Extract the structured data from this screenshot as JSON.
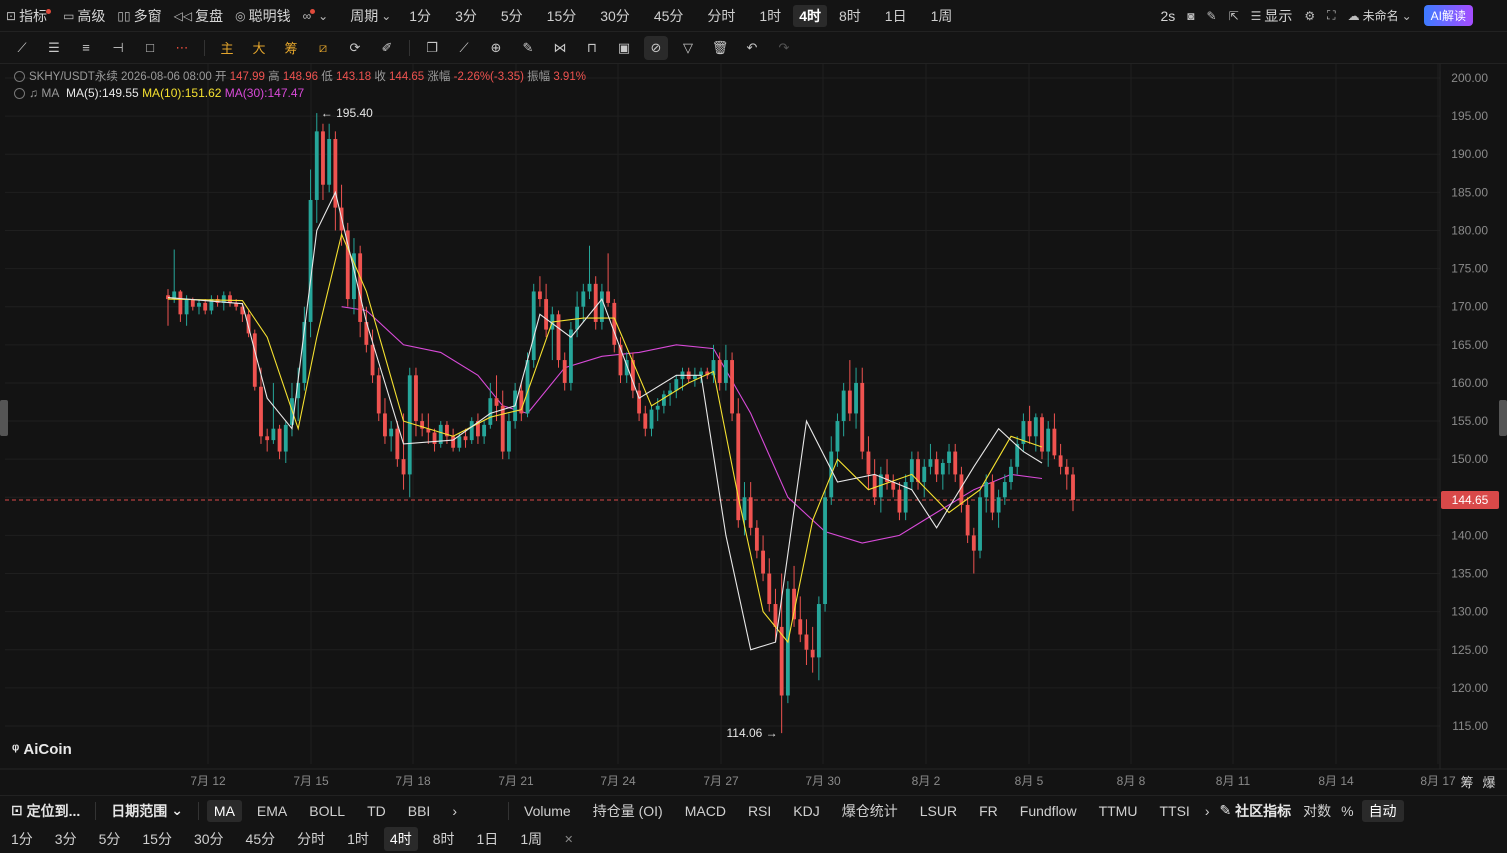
{
  "topbar": {
    "items": [
      {
        "icon": "chart-box-icon",
        "label": "指标",
        "dot": true
      },
      {
        "icon": "folder-icon",
        "label": "高级"
      },
      {
        "icon": "grid-icon",
        "label": "多窗"
      },
      {
        "icon": "rewind-icon",
        "label": "复盘"
      },
      {
        "icon": "brain-icon",
        "label": "聪明钱"
      },
      {
        "icon": "glasses-icon",
        "label": "",
        "dot": true
      }
    ],
    "period_dropdown": "周期",
    "periods": [
      "1分",
      "3分",
      "5分",
      "15分",
      "30分",
      "45分",
      "分时",
      "1时",
      "4时",
      "8时",
      "1日",
      "1周"
    ],
    "active_period": "4时",
    "refresh": "2s",
    "display_label": "显示",
    "unnamed_label": "未命名",
    "ai_label": "AI解读"
  },
  "toolbar": {
    "tools_left": [
      "line-icon",
      "parallel-icon",
      "horizontal-lines-icon",
      "ray-icon",
      "rect-icon",
      "dots-icon"
    ],
    "text_tools": [
      "主",
      "大",
      "筹"
    ],
    "tools_right": [
      "measure-icon",
      "pattern-icon",
      "pencil-icon",
      "clone-icon",
      "ruler-icon",
      "zoom-icon",
      "brush-icon",
      "magnet-icon",
      "lock-icon",
      "ruler2-icon",
      "link-icon",
      "filter-icon",
      "trash-icon",
      "undo-icon",
      "redo-icon"
    ]
  },
  "header": {
    "symbol": "SKHY/USDT永续",
    "datetime": "2026-08-06 08:00",
    "open_label": "开",
    "open": "147.99",
    "high_label": "高",
    "high": "148.96",
    "low_label": "低",
    "low": "143.18",
    "close_label": "收",
    "close": "144.65",
    "change_label": "涨幅",
    "change": "-2.26%(-3.35)",
    "amp_label": "振幅",
    "amp": "3.91%",
    "ma_label": "MA",
    "ma5": "MA(5):149.55",
    "ma10": "MA(10):151.62",
    "ma30": "MA(30):147.47"
  },
  "colors": {
    "up": "#26a69a",
    "down": "#ef5350",
    "ma5": "#e8e8e8",
    "ma10": "#f5e130",
    "ma30": "#d84ad8",
    "price_line": "#d94949"
  },
  "current_price": "144.65",
  "max_label": "195.40",
  "min_label": "114.06",
  "logo": "AiCoin",
  "chart_data": {
    "type": "candlestick",
    "symbol": "SKHY/USDT永续",
    "interval": "4h",
    "y_ticks": [
      115,
      120,
      125,
      130,
      135,
      140,
      145,
      150,
      155,
      160,
      165,
      170,
      175,
      180,
      185,
      190,
      195,
      200
    ],
    "y_tick_labels": [
      "115.00",
      "120.00",
      "125.00",
      "130.00",
      "135.00",
      "140.00",
      "145.00",
      "150.00",
      "155.00",
      "160.00",
      "165.00",
      "170.00",
      "175.00",
      "180.00",
      "185.00",
      "190.00",
      "195.00",
      "200.00"
    ],
    "x_labels": [
      "7月 12",
      "7月 15",
      "7月 18",
      "7月 21",
      "7月 24",
      "7月 27",
      "7月 30",
      "8月 2",
      "8月 5",
      "8月 8",
      "8月 11",
      "8月 14",
      "8月 17"
    ],
    "ylim": [
      112,
      202
    ],
    "candles": [
      [
        171.5,
        172.3,
        167.5,
        171.0
      ],
      [
        171.0,
        177.5,
        170.5,
        172.0
      ],
      [
        172.0,
        172.2,
        168.0,
        169.0
      ],
      [
        169.0,
        171.5,
        167.5,
        171.0
      ],
      [
        171.0,
        171.2,
        169.5,
        170.0
      ],
      [
        170.0,
        171.0,
        169.0,
        170.5
      ],
      [
        170.5,
        171.0,
        169.0,
        169.5
      ],
      [
        169.5,
        171.5,
        169.0,
        171.0
      ],
      [
        171.0,
        171.5,
        170.0,
        170.5
      ],
      [
        170.5,
        172.0,
        169.5,
        171.5
      ],
      [
        171.5,
        172.0,
        170.0,
        170.5
      ],
      [
        170.5,
        171.0,
        169.5,
        170.0
      ],
      [
        170.0,
        170.5,
        168.0,
        169.0
      ],
      [
        169.0,
        169.5,
        166.0,
        166.5
      ],
      [
        166.5,
        167.0,
        159.0,
        159.5
      ],
      [
        159.5,
        162.0,
        152.0,
        153.0
      ],
      [
        153.0,
        154.0,
        151.0,
        152.5
      ],
      [
        152.5,
        160.0,
        152.0,
        154.0
      ],
      [
        154.0,
        154.5,
        150.0,
        151.0
      ],
      [
        151.0,
        155.0,
        149.5,
        154.5
      ],
      [
        154.5,
        160.0,
        153.0,
        158.0
      ],
      [
        158.0,
        162.0,
        155.0,
        160.0
      ],
      [
        160.0,
        170.0,
        159.0,
        168.0
      ],
      [
        168.0,
        188.0,
        166.0,
        184.0
      ],
      [
        184.0,
        195.4,
        181.0,
        193.0
      ],
      [
        193.0,
        194.0,
        184.0,
        186.0
      ],
      [
        186.0,
        194.0,
        185.0,
        192.0
      ],
      [
        192.0,
        193.0,
        180.0,
        183.0
      ],
      [
        183.0,
        186.0,
        178.0,
        180.0
      ],
      [
        180.0,
        181.0,
        170.0,
        171.0
      ],
      [
        171.0,
        179.0,
        169.0,
        177.0
      ],
      [
        177.0,
        178.0,
        166.0,
        168.0
      ],
      [
        168.0,
        170.0,
        164.0,
        165.0
      ],
      [
        165.0,
        167.0,
        160.0,
        161.0
      ],
      [
        161.0,
        162.0,
        155.0,
        156.0
      ],
      [
        156.0,
        158.0,
        152.0,
        153.0
      ],
      [
        153.0,
        155.0,
        151.0,
        154.0
      ],
      [
        154.0,
        155.0,
        149.0,
        150.0
      ],
      [
        150.0,
        156.0,
        146.0,
        148.0
      ],
      [
        148.0,
        162.0,
        145.0,
        161.0
      ],
      [
        161.0,
        162.0,
        153.0,
        155.0
      ],
      [
        155.0,
        156.0,
        153.0,
        154.0
      ],
      [
        154.0,
        156.0,
        152.0,
        153.5
      ],
      [
        153.5,
        154.0,
        151.0,
        152.0
      ],
      [
        152.0,
        155.0,
        151.5,
        154.5
      ],
      [
        154.5,
        155.0,
        152.0,
        153.0
      ],
      [
        153.0,
        154.0,
        151.0,
        151.5
      ],
      [
        151.5,
        153.5,
        151.0,
        153.0
      ],
      [
        153.0,
        154.0,
        151.5,
        152.5
      ],
      [
        152.5,
        155.5,
        152.0,
        155.0
      ],
      [
        155.0,
        156.0,
        152.0,
        153.0
      ],
      [
        153.0,
        155.0,
        152.0,
        154.5
      ],
      [
        154.5,
        160.0,
        154.0,
        158.0
      ],
      [
        158.0,
        161.0,
        155.0,
        157.0
      ],
      [
        157.0,
        159.0,
        150.0,
        151.0
      ],
      [
        151.0,
        156.0,
        150.0,
        155.0
      ],
      [
        155.0,
        160.0,
        154.0,
        159.0
      ],
      [
        159.0,
        160.0,
        155.0,
        156.0
      ],
      [
        156.0,
        164.0,
        155.5,
        163.0
      ],
      [
        163.0,
        173.0,
        162.0,
        172.0
      ],
      [
        172.0,
        174.0,
        170.0,
        171.0
      ],
      [
        171.0,
        173.0,
        166.0,
        167.0
      ],
      [
        167.0,
        170.0,
        163.0,
        169.0
      ],
      [
        169.0,
        169.5,
        162.0,
        163.0
      ],
      [
        163.0,
        164.0,
        159.0,
        160.0
      ],
      [
        160.0,
        168.0,
        159.0,
        167.0
      ],
      [
        167.0,
        172.0,
        166.0,
        170.0
      ],
      [
        170.0,
        173.0,
        168.0,
        172.0
      ],
      [
        172.0,
        178.0,
        171.0,
        173.0
      ],
      [
        173.0,
        174.0,
        167.0,
        168.0
      ],
      [
        168.0,
        173.0,
        167.0,
        172.0
      ],
      [
        172.0,
        177.0,
        170.0,
        170.5
      ],
      [
        170.5,
        171.0,
        164.0,
        165.0
      ],
      [
        165.0,
        166.0,
        160.0,
        161.0
      ],
      [
        161.0,
        164.0,
        160.0,
        163.0
      ],
      [
        163.0,
        164.0,
        158.0,
        159.0
      ],
      [
        159.0,
        160.0,
        155.0,
        156.0
      ],
      [
        156.0,
        157.0,
        153.0,
        154.0
      ],
      [
        154.0,
        157.0,
        153.0,
        156.5
      ],
      [
        156.5,
        158.0,
        155.0,
        157.0
      ],
      [
        157.0,
        159.0,
        156.0,
        158.5
      ],
      [
        158.5,
        160.0,
        157.0,
        159.0
      ],
      [
        159.0,
        161.0,
        158.0,
        160.5
      ],
      [
        160.5,
        162.0,
        159.0,
        161.5
      ],
      [
        161.5,
        162.0,
        160.0,
        160.5
      ],
      [
        160.5,
        162.0,
        159.5,
        161.0
      ],
      [
        161.0,
        162.0,
        160.0,
        161.5
      ],
      [
        161.5,
        162.0,
        160.5,
        161.0
      ],
      [
        161.0,
        165.0,
        160.0,
        163.0
      ],
      [
        163.0,
        164.0,
        159.0,
        160.0
      ],
      [
        160.0,
        165.0,
        159.0,
        163.0
      ],
      [
        163.0,
        164.0,
        155.0,
        156.0
      ],
      [
        156.0,
        158.0,
        141.0,
        142.0
      ],
      [
        142.0,
        147.0,
        140.0,
        145.0
      ],
      [
        145.0,
        147.0,
        140.0,
        141.0
      ],
      [
        141.0,
        142.0,
        137.0,
        138.0
      ],
      [
        138.0,
        140.0,
        134.0,
        135.0
      ],
      [
        135.0,
        137.0,
        130.0,
        131.0
      ],
      [
        131.0,
        133.0,
        126.0,
        128.0
      ],
      [
        128.0,
        135.0,
        114.06,
        119.0
      ],
      [
        119.0,
        134.0,
        118.0,
        133.0
      ],
      [
        133.0,
        136.0,
        128.0,
        129.0
      ],
      [
        129.0,
        132.0,
        126.0,
        127.0
      ],
      [
        127.0,
        129.0,
        123.0,
        125.0
      ],
      [
        125.0,
        128.0,
        122.0,
        124.0
      ],
      [
        124.0,
        132.0,
        121.0,
        131.0
      ],
      [
        131.0,
        146.0,
        130.0,
        145.0
      ],
      [
        145.0,
        153.0,
        144.0,
        151.0
      ],
      [
        151.0,
        156.0,
        149.0,
        155.0
      ],
      [
        155.0,
        160.0,
        153.0,
        159.0
      ],
      [
        159.0,
        163.0,
        155.0,
        156.0
      ],
      [
        156.0,
        162.0,
        154.0,
        160.0
      ],
      [
        160.0,
        162.0,
        150.0,
        151.0
      ],
      [
        151.0,
        153.0,
        146.0,
        148.0
      ],
      [
        148.0,
        150.0,
        144.0,
        145.0
      ],
      [
        145.0,
        149.0,
        143.0,
        148.0
      ],
      [
        148.0,
        150.0,
        146.0,
        147.0
      ],
      [
        147.0,
        148.0,
        145.0,
        146.0
      ],
      [
        146.0,
        147.0,
        142.0,
        143.0
      ],
      [
        143.0,
        148.0,
        142.0,
        147.0
      ],
      [
        147.0,
        151.0,
        146.0,
        150.0
      ],
      [
        150.0,
        151.0,
        146.0,
        147.0
      ],
      [
        147.0,
        150.0,
        145.0,
        149.0
      ],
      [
        149.0,
        152.0,
        148.0,
        150.0
      ],
      [
        150.0,
        151.0,
        147.0,
        148.0
      ],
      [
        148.0,
        150.0,
        146.0,
        149.5
      ],
      [
        149.5,
        152.0,
        148.0,
        151.0
      ],
      [
        151.0,
        152.0,
        147.0,
        148.0
      ],
      [
        148.0,
        149.0,
        143.0,
        144.0
      ],
      [
        144.0,
        145.0,
        139.0,
        140.0
      ],
      [
        140.0,
        141.0,
        135.0,
        138.0
      ],
      [
        138.0,
        146.0,
        137.0,
        145.0
      ],
      [
        145.0,
        148.0,
        143.0,
        147.0
      ],
      [
        147.0,
        148.0,
        142.0,
        143.0
      ],
      [
        143.0,
        146.0,
        141.0,
        145.0
      ],
      [
        145.0,
        148.0,
        144.0,
        147.0
      ],
      [
        147.0,
        150.0,
        146.0,
        149.0
      ],
      [
        149.0,
        153.0,
        148.0,
        152.0
      ],
      [
        152.0,
        156.0,
        151.0,
        155.0
      ],
      [
        155.0,
        157.0,
        152.0,
        153.0
      ],
      [
        153.0,
        156.0,
        151.0,
        155.5
      ],
      [
        155.5,
        156.0,
        150.0,
        151.0
      ],
      [
        151.0,
        155.0,
        149.0,
        154.0
      ],
      [
        154.0,
        156.0,
        150.0,
        150.5
      ],
      [
        150.5,
        152.0,
        148.0,
        149.0
      ],
      [
        149.0,
        150.0,
        146.0,
        147.99
      ],
      [
        147.99,
        148.96,
        143.18,
        144.65
      ]
    ],
    "ma5": [
      [
        0,
        171.2
      ],
      [
        12,
        170.4
      ],
      [
        16,
        158.0
      ],
      [
        20,
        154.0
      ],
      [
        24,
        180.0
      ],
      [
        27,
        185.0
      ],
      [
        32,
        168.0
      ],
      [
        38,
        152.0
      ],
      [
        46,
        152.5
      ],
      [
        52,
        156.0
      ],
      [
        56,
        157.0
      ],
      [
        60,
        169.0
      ],
      [
        65,
        166.0
      ],
      [
        70,
        171.0
      ],
      [
        76,
        158.0
      ],
      [
        82,
        161.0
      ],
      [
        86,
        161.0
      ],
      [
        90,
        140.0
      ],
      [
        94,
        125.0
      ],
      [
        98,
        126.0
      ],
      [
        103,
        155.0
      ],
      [
        108,
        147.0
      ],
      [
        114,
        148.0
      ],
      [
        120,
        146.0
      ],
      [
        124,
        141.0
      ],
      [
        130,
        149.0
      ],
      [
        134,
        154.0
      ],
      [
        138,
        151.0
      ],
      [
        141,
        149.5
      ]
    ],
    "ma10": [
      [
        0,
        171.0
      ],
      [
        12,
        170.8
      ],
      [
        16,
        166.0
      ],
      [
        21,
        154.0
      ],
      [
        24,
        166.0
      ],
      [
        28,
        179.5
      ],
      [
        32,
        172.0
      ],
      [
        38,
        155.0
      ],
      [
        46,
        153.0
      ],
      [
        52,
        155.5
      ],
      [
        57,
        156.5
      ],
      [
        62,
        168.0
      ],
      [
        67,
        168.5
      ],
      [
        72,
        168.5
      ],
      [
        78,
        157.0
      ],
      [
        84,
        160.0
      ],
      [
        88,
        161.5
      ],
      [
        92,
        145.0
      ],
      [
        96,
        130.0
      ],
      [
        100,
        126.0
      ],
      [
        104,
        142.0
      ],
      [
        108,
        150.0
      ],
      [
        113,
        146.0
      ],
      [
        120,
        148.0
      ],
      [
        126,
        143.0
      ],
      [
        131,
        146.0
      ],
      [
        136,
        153.0
      ],
      [
        141,
        151.6
      ]
    ],
    "ma30": [
      [
        28,
        170.0
      ],
      [
        32,
        169.5
      ],
      [
        38,
        165.0
      ],
      [
        44,
        164.0
      ],
      [
        50,
        161.0
      ],
      [
        54,
        157.0
      ],
      [
        58,
        156.0
      ],
      [
        64,
        162.0
      ],
      [
        70,
        163.5
      ],
      [
        76,
        164.0
      ],
      [
        82,
        165.0
      ],
      [
        88,
        164.5
      ],
      [
        94,
        156.0
      ],
      [
        100,
        145.0
      ],
      [
        106,
        140.5
      ],
      [
        112,
        139.0
      ],
      [
        118,
        140.0
      ],
      [
        124,
        143.0
      ],
      [
        130,
        146.0
      ],
      [
        136,
        148.0
      ],
      [
        141,
        147.47
      ]
    ]
  },
  "bottom": {
    "locate": "定位到...",
    "date_range": "日期范围",
    "main_indicators": [
      "MA",
      "EMA",
      "BOLL",
      "TD",
      "BBI"
    ],
    "sub_indicators": [
      "Volume",
      "持仓量 (OI)",
      "MACD",
      "RSI",
      "KDJ",
      "爆仓统计",
      "LSUR",
      "FR",
      "Fundflow",
      "TTMU",
      "TTSI"
    ],
    "community": "社区指标",
    "log_label": "对数",
    "pct_label": "%",
    "auto_label": "自动",
    "periods": [
      "1分",
      "3分",
      "5分",
      "15分",
      "30分",
      "45分",
      "分时",
      "1时",
      "4时",
      "8时",
      "1日",
      "1周"
    ],
    "active_period": "4时",
    "side_labels": [
      "筹",
      "爆"
    ]
  }
}
